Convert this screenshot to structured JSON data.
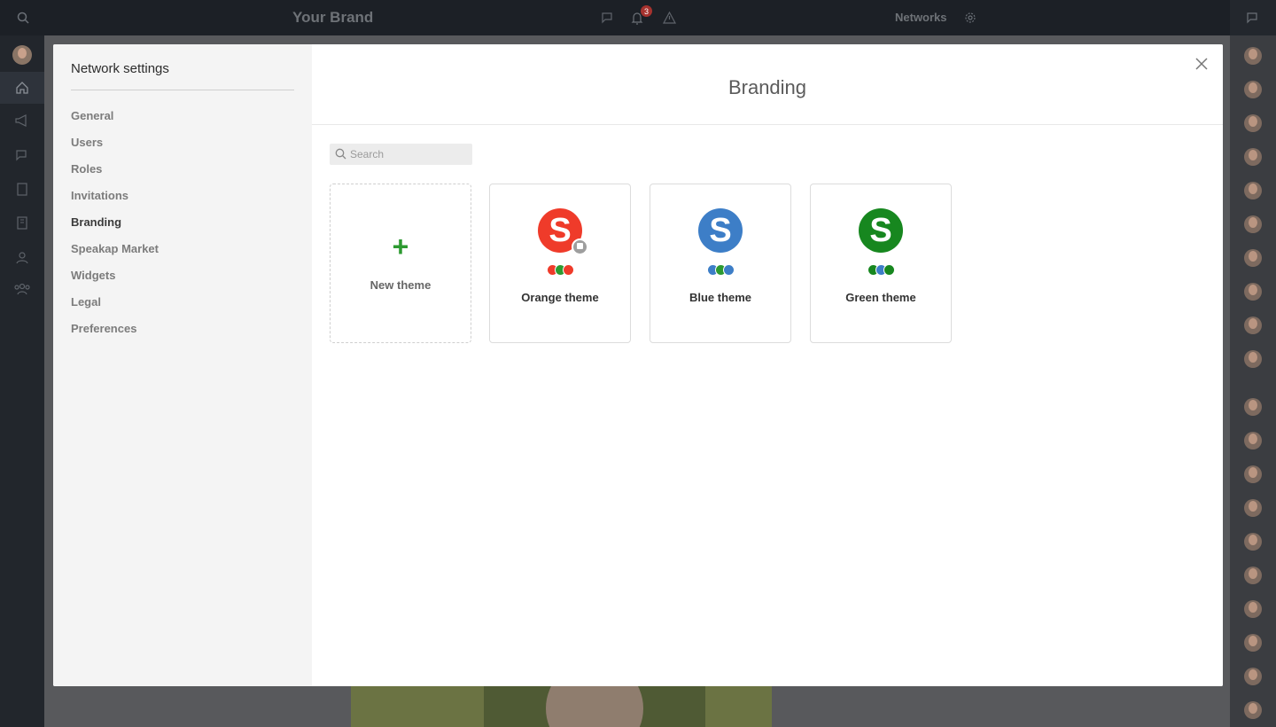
{
  "app": {
    "brand": "Your Brand",
    "notification_count": "3",
    "networks_label": "Networks"
  },
  "settings": {
    "title": "Network settings",
    "nav": [
      {
        "label": "General"
      },
      {
        "label": "Users"
      },
      {
        "label": "Roles"
      },
      {
        "label": "Invitations"
      },
      {
        "label": "Branding",
        "active": true
      },
      {
        "label": "Speakap Market"
      },
      {
        "label": "Widgets"
      },
      {
        "label": "Legal"
      },
      {
        "label": "Preferences"
      }
    ]
  },
  "branding": {
    "title": "Branding",
    "search_placeholder": "Search",
    "new_theme_label": "New theme",
    "themes": [
      {
        "label": "Orange theme",
        "logo_letter": "S",
        "logo_color": "#ef3b2a",
        "swatches": [
          "#ef3b2a",
          "#2d9a31",
          "#ef3b2a"
        ],
        "locked": true
      },
      {
        "label": "Blue theme",
        "logo_letter": "S",
        "logo_color": "#3d7ec7",
        "swatches": [
          "#3d7ec7",
          "#2d9a31",
          "#3d7ec7"
        ],
        "locked": false
      },
      {
        "label": "Green theme",
        "logo_letter": "S",
        "logo_color": "#17871f",
        "swatches": [
          "#17871f",
          "#3d7ec7",
          "#17871f"
        ],
        "locked": false
      }
    ]
  },
  "colors": {
    "accent_green": "#2d9a31",
    "topbar": "#1c2026",
    "badge": "#a6322e"
  }
}
